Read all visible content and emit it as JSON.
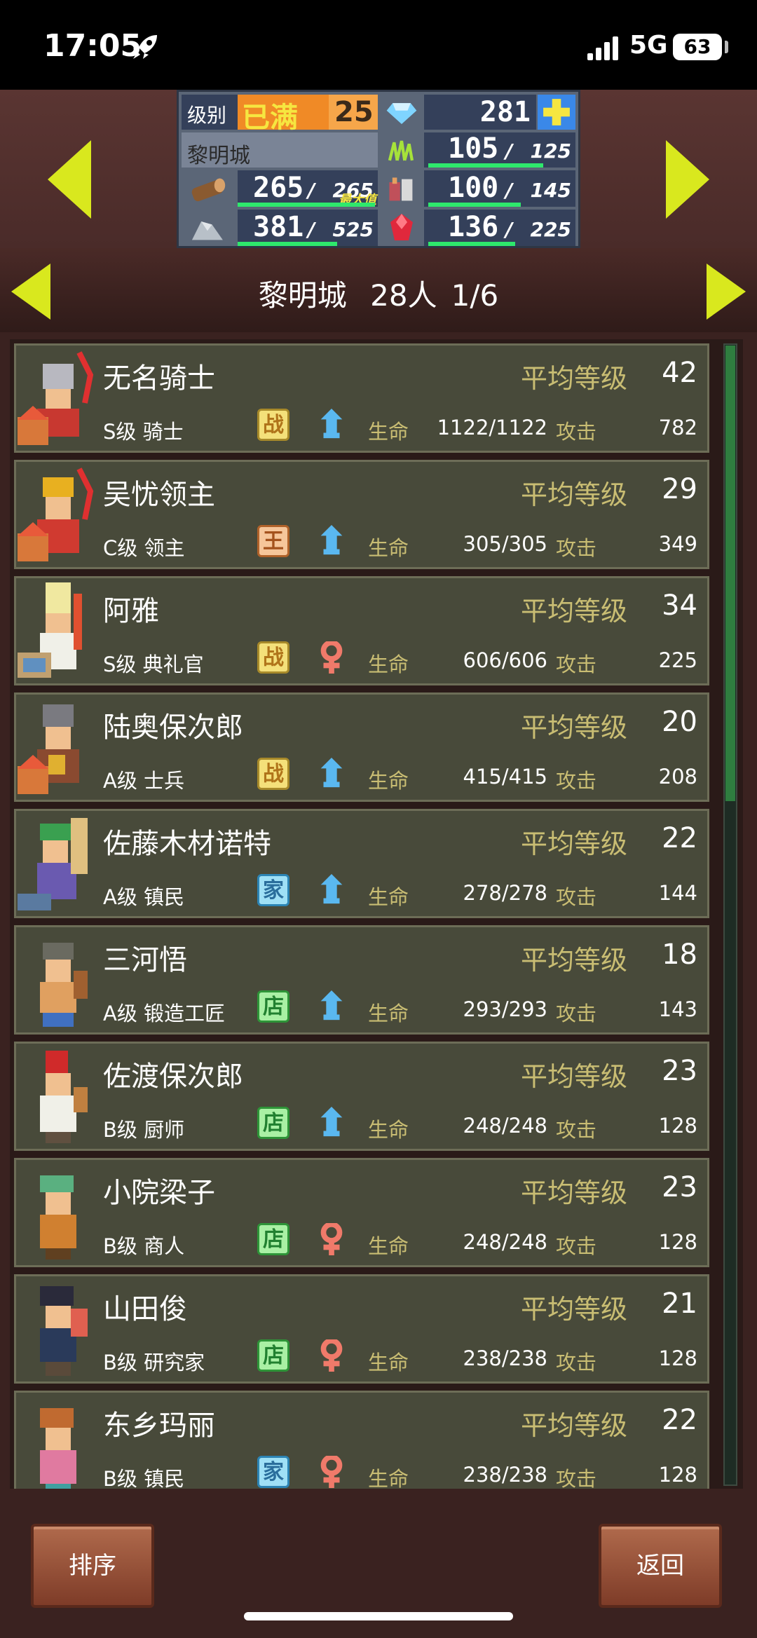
{
  "status_bar": {
    "time": "17:05",
    "network": "5G",
    "battery": "63"
  },
  "resources": {
    "rank_label": "级别",
    "rank_status": "已满",
    "rank_level": "25",
    "gems": "281",
    "city_name": "黎明城",
    "r1_current": "105",
    "r1_max": "125",
    "wood_current": "265",
    "wood_max": "265",
    "wood_note": "最大值",
    "r2_current": "100",
    "r2_max": "145",
    "stone_current": "381",
    "stone_max": "525",
    "ruby_current": "136",
    "ruby_max": "225",
    "colors": {
      "bar": "#2ee86c",
      "arrow": "#d9e81e"
    }
  },
  "list_header": {
    "city": "黎明城",
    "count": "28人",
    "page": "1/6"
  },
  "labels": {
    "avg_level": "平均等级",
    "hp": "生命",
    "atk": "攻击"
  },
  "characters": [
    {
      "name": "无名骑士",
      "level": "42",
      "rank": "S级 骑士",
      "tag": "战",
      "gender": "male",
      "hp": "1122/1122",
      "atk": "782"
    },
    {
      "name": "吴忧领主",
      "level": "29",
      "rank": "C级 领主",
      "tag": "王",
      "gender": "male",
      "hp": "305/305",
      "atk": "349"
    },
    {
      "name": "阿雅",
      "level": "34",
      "rank": "S级 典礼官",
      "tag": "战",
      "gender": "female",
      "hp": "606/606",
      "atk": "225"
    },
    {
      "name": "陆奥保次郎",
      "level": "20",
      "rank": "A级 士兵",
      "tag": "战",
      "gender": "male",
      "hp": "415/415",
      "atk": "208"
    },
    {
      "name": "佐藤木材诺特",
      "level": "22",
      "rank": "A级 镇民",
      "tag": "家",
      "gender": "male",
      "hp": "278/278",
      "atk": "144"
    },
    {
      "name": "三河悟",
      "level": "18",
      "rank": "A级 锻造工匠",
      "tag": "店",
      "gender": "male",
      "hp": "293/293",
      "atk": "143"
    },
    {
      "name": "佐渡保次郎",
      "level": "23",
      "rank": "B级 厨师",
      "tag": "店",
      "gender": "male",
      "hp": "248/248",
      "atk": "128"
    },
    {
      "name": "小院梁子",
      "level": "23",
      "rank": "B级 商人",
      "tag": "店",
      "gender": "female",
      "hp": "248/248",
      "atk": "128"
    },
    {
      "name": "山田俊",
      "level": "21",
      "rank": "B级 研究家",
      "tag": "店",
      "gender": "female",
      "hp": "238/238",
      "atk": "128"
    },
    {
      "name": "东乡玛丽",
      "level": "22",
      "rank": "B级 镇民",
      "tag": "家",
      "gender": "female",
      "hp": "238/238",
      "atk": "128"
    }
  ],
  "buttons": {
    "sort": "排序",
    "back": "返回"
  }
}
